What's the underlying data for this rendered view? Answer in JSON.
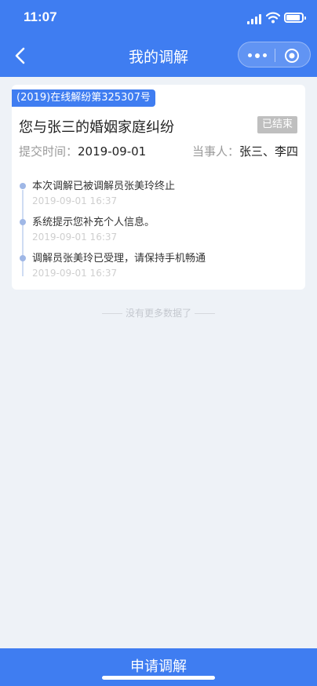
{
  "status_bar": {
    "time": "11:07"
  },
  "nav": {
    "title": "我的调解"
  },
  "case": {
    "number_tag": "(2019)在线解纷第325307号",
    "title": "您与张三的婚姻家庭纠纷",
    "status": "已结束",
    "submit_label": "提交时间：",
    "submit_time": "2019-09-01",
    "party_label": "当事人：",
    "parties": "张三、李四",
    "timeline": [
      {
        "text": "本次调解已被调解员张美玲终止",
        "time": "2019-09-01 16:37"
      },
      {
        "text": "系统提示您补充个人信息。",
        "time": "2019-09-01 16:37"
      },
      {
        "text": "调解员张美玲已受理，请保持手机畅通",
        "time": "2019-09-01 16:37"
      }
    ]
  },
  "list_footer": "没有更多数据了",
  "bottom_button": {
    "label": "申请调解"
  },
  "colors": {
    "primary": "#3f7df1",
    "status_done": "#bfbfbf",
    "page_bg": "#eef2f7"
  }
}
